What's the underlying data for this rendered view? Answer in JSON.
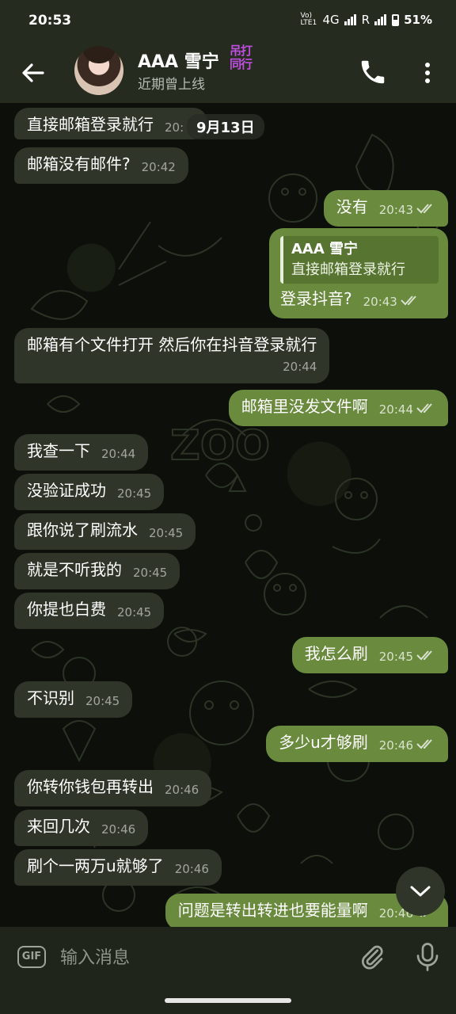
{
  "status_bar": {
    "time": "20:53",
    "network": "Vo) LTE1",
    "net_type": "4G",
    "roaming": "R",
    "battery": "51%"
  },
  "header": {
    "name": "AAA 雪宁",
    "tag_line1": "吊打",
    "tag_line2": "同行",
    "status": "近期曾上线"
  },
  "date_label": "9月13日",
  "messages": [
    {
      "dir": "in",
      "text": "直接邮箱登录就行",
      "time": "20:"
    },
    {
      "dir": "in",
      "text": "邮箱没有邮件?",
      "time": "20:42"
    },
    {
      "dir": "out",
      "text": "没有",
      "time": "20:43"
    },
    {
      "dir": "out",
      "reply_name": "AAA 雪宁",
      "reply_text": "直接邮箱登录就行",
      "text": "登录抖音?",
      "time": "20:43"
    },
    {
      "dir": "in",
      "text": "邮箱有个文件打开 然后你在抖音登录就行",
      "time": "20:44"
    },
    {
      "dir": "out",
      "text": "邮箱里没发文件啊",
      "time": "20:44"
    },
    {
      "dir": "in",
      "text": "我查一下",
      "time": "20:44"
    },
    {
      "dir": "in",
      "text": "没验证成功",
      "time": "20:45"
    },
    {
      "dir": "in",
      "text": "跟你说了刷流水",
      "time": "20:45"
    },
    {
      "dir": "in",
      "text": "就是不听我的",
      "time": "20:45"
    },
    {
      "dir": "in",
      "text": "你提也白费",
      "time": "20:45"
    },
    {
      "dir": "out",
      "text": "我怎么刷",
      "time": "20:45"
    },
    {
      "dir": "in",
      "text": "不识别",
      "time": "20:45"
    },
    {
      "dir": "out",
      "text": "多少u才够刷",
      "time": "20:46"
    },
    {
      "dir": "in",
      "text": "你转你钱包再转出",
      "time": "20:46"
    },
    {
      "dir": "in",
      "text": "来回几次",
      "time": "20:46"
    },
    {
      "dir": "in",
      "text": "刷个一两万u就够了",
      "time": "20:46"
    },
    {
      "dir": "out",
      "text": "问题是转出转进也要能量啊",
      "time": "20:46"
    }
  ],
  "input": {
    "placeholder": "输入消息",
    "gif_label": "GIF"
  },
  "icons": {
    "back": "arrow-left-icon",
    "call": "phone-icon",
    "more": "more-vert-icon",
    "attach": "paperclip-icon",
    "mic": "microphone-icon",
    "scroll": "chevron-down-icon",
    "read": "double-check-icon"
  },
  "colors": {
    "outgoing_bubble": "#6a8a3e",
    "incoming_bubble": "#2f3528",
    "header_bg": "#262b20",
    "tag": "#c04ee0"
  }
}
